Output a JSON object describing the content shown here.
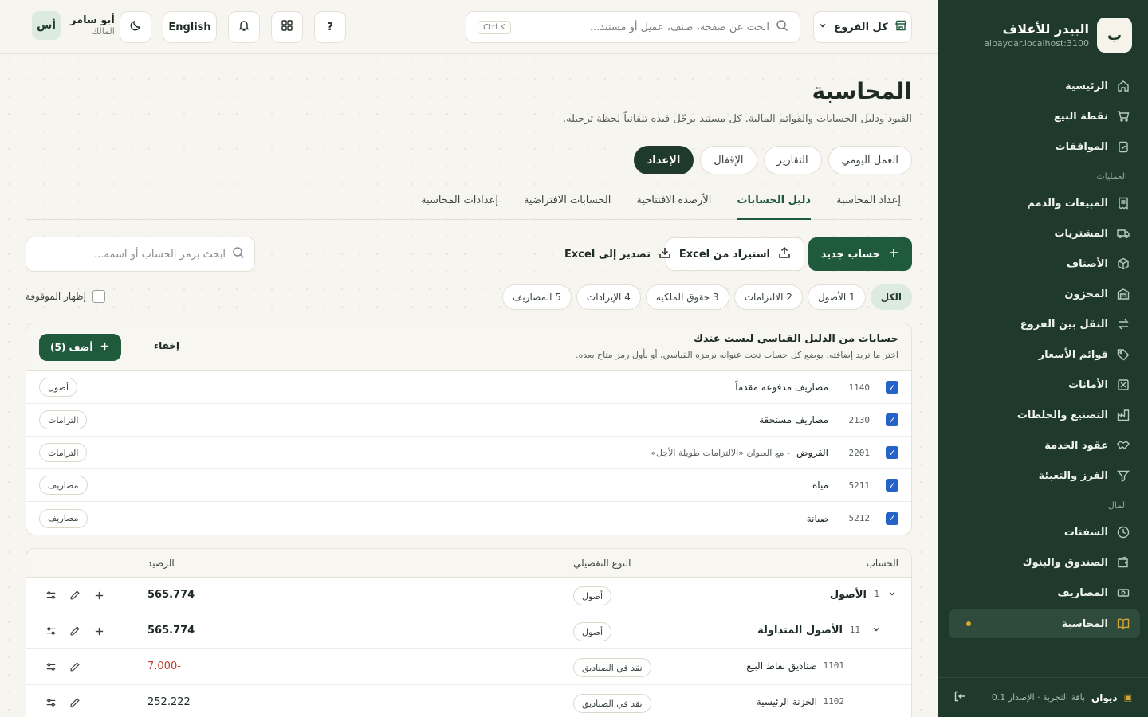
{
  "sidebar": {
    "brand_initial": "ب",
    "brand_name": "البيدر للأعلاف",
    "brand_host": "albaydar.localhost:3100",
    "items_top": [
      {
        "label": "الرئيسية",
        "icon": "home-icon"
      },
      {
        "label": "نقطة البيع",
        "icon": "cart-icon"
      },
      {
        "label": "الموافقات",
        "icon": "clipboard-check-icon"
      }
    ],
    "section_operations": "العمليات",
    "items_ops": [
      {
        "label": "المبيعات والذمم",
        "icon": "receipt-icon"
      },
      {
        "label": "المشتريات",
        "icon": "truck-icon"
      },
      {
        "label": "الأصناف",
        "icon": "box-icon"
      },
      {
        "label": "المخزون",
        "icon": "warehouse-icon"
      },
      {
        "label": "النقل بين الفروع",
        "icon": "transfer-icon"
      },
      {
        "label": "قوائم الأسعار",
        "icon": "tag-icon"
      },
      {
        "label": "الأمانات",
        "icon": "consignment-icon"
      },
      {
        "label": "التصنيع والخلطات",
        "icon": "factory-icon"
      },
      {
        "label": "عقود الخدمة",
        "icon": "handshake-icon"
      },
      {
        "label": "الفرز والتعبئة",
        "icon": "filter-icon"
      }
    ],
    "section_money": "المال",
    "items_money": [
      {
        "label": "الشفتات",
        "icon": "clock-icon"
      },
      {
        "label": "الصندوق والبنوك",
        "icon": "wallet-icon"
      },
      {
        "label": "المصاريف",
        "icon": "banknote-icon"
      },
      {
        "label": "المحاسبة",
        "icon": "book-icon",
        "active": true
      }
    ],
    "footer": {
      "product": "ديوان",
      "plan": "باقة التجربة · الإصدار 0.1"
    }
  },
  "topbar": {
    "branch_label": "كل الفروع",
    "search_placeholder": "ابحث عن صفحة، صنف، عميل أو مستند...",
    "search_shortcut": "Ctrl K",
    "help_label": "?",
    "lang_label": "English",
    "user_initials": "أس",
    "user_name": "أبو سامر",
    "user_role": "المالك"
  },
  "page": {
    "title": "المحاسبة",
    "subtitle": "القيود ودليل الحسابات والقوائم المالية. كل مستند يرحّل قيده تلقائياً لحظة ترحيله.",
    "pills": [
      "العمل اليومي",
      "التقارير",
      "الإقفال",
      "الإعداد"
    ],
    "active_pill": "الإعداد",
    "subtabs": [
      "إعداد المحاسبة",
      "دليل الحسابات",
      "الأرصدة الافتتاحية",
      "الحسابات الافتراضية",
      "إعدادات المحاسبة"
    ],
    "active_subtab": "دليل الحسابات"
  },
  "toolbar": {
    "new_account": "حساب جديد",
    "import_excel": "استيراد من Excel",
    "export_excel": "تصدير إلى Excel",
    "account_search_placeholder": "ابحث برمز الحساب أو اسمه..."
  },
  "filters": {
    "items": [
      "الكل",
      "1 الأصول",
      "2 الالتزامات",
      "3 حقوق الملكية",
      "4 الإيرادات",
      "5 المصاريف"
    ],
    "active": "الكل",
    "show_stopped": "إظهار الموقوفة"
  },
  "suggestions": {
    "title": "حسابات من الدليل القياسي ليست عندك",
    "description": "اختر ما تريد إضافته. يوضع كل حساب تحت عنوانه برمزه القياسي، أو بأول رمز متاح بعده.",
    "add_button": "أضف (5)",
    "hide_button": "إخفاء",
    "rows": [
      {
        "code": "1140",
        "name": "مصاريف مدفوعة مقدماً",
        "note": "",
        "tag": "أصول"
      },
      {
        "code": "2130",
        "name": "مصاريف مستحقة",
        "note": "",
        "tag": "التزامات"
      },
      {
        "code": "2201",
        "name": "القروض",
        "note": "- مع العنوان «الالتزامات طويلة الأجل»",
        "tag": "التزامات"
      },
      {
        "code": "5211",
        "name": "مياه",
        "note": "",
        "tag": "مصاريف"
      },
      {
        "code": "5212",
        "name": "صيانة",
        "note": "",
        "tag": "مصاريف"
      }
    ]
  },
  "accounts": {
    "headers": {
      "account": "الحساب",
      "type": "النوع التفصيلي",
      "balance": "الرصيد"
    },
    "rows": [
      {
        "code": "1",
        "name": "الأصول",
        "type": "أصول",
        "balance": "565.774",
        "level": 0,
        "group": true
      },
      {
        "code": "11",
        "name": "الأصول المتداولة",
        "type": "أصول",
        "balance": "565.774",
        "level": 1,
        "group": true
      },
      {
        "code": "1101",
        "name": "صناديق نقاط البيع",
        "type": "نقد في الصناديق",
        "balance": "7.000-",
        "level": 2,
        "group": false,
        "negative": true
      },
      {
        "code": "1102",
        "name": "الخزنة الرئيسية",
        "type": "نقد في الصناديق",
        "balance": "252.222",
        "level": 2,
        "group": false
      }
    ]
  }
}
